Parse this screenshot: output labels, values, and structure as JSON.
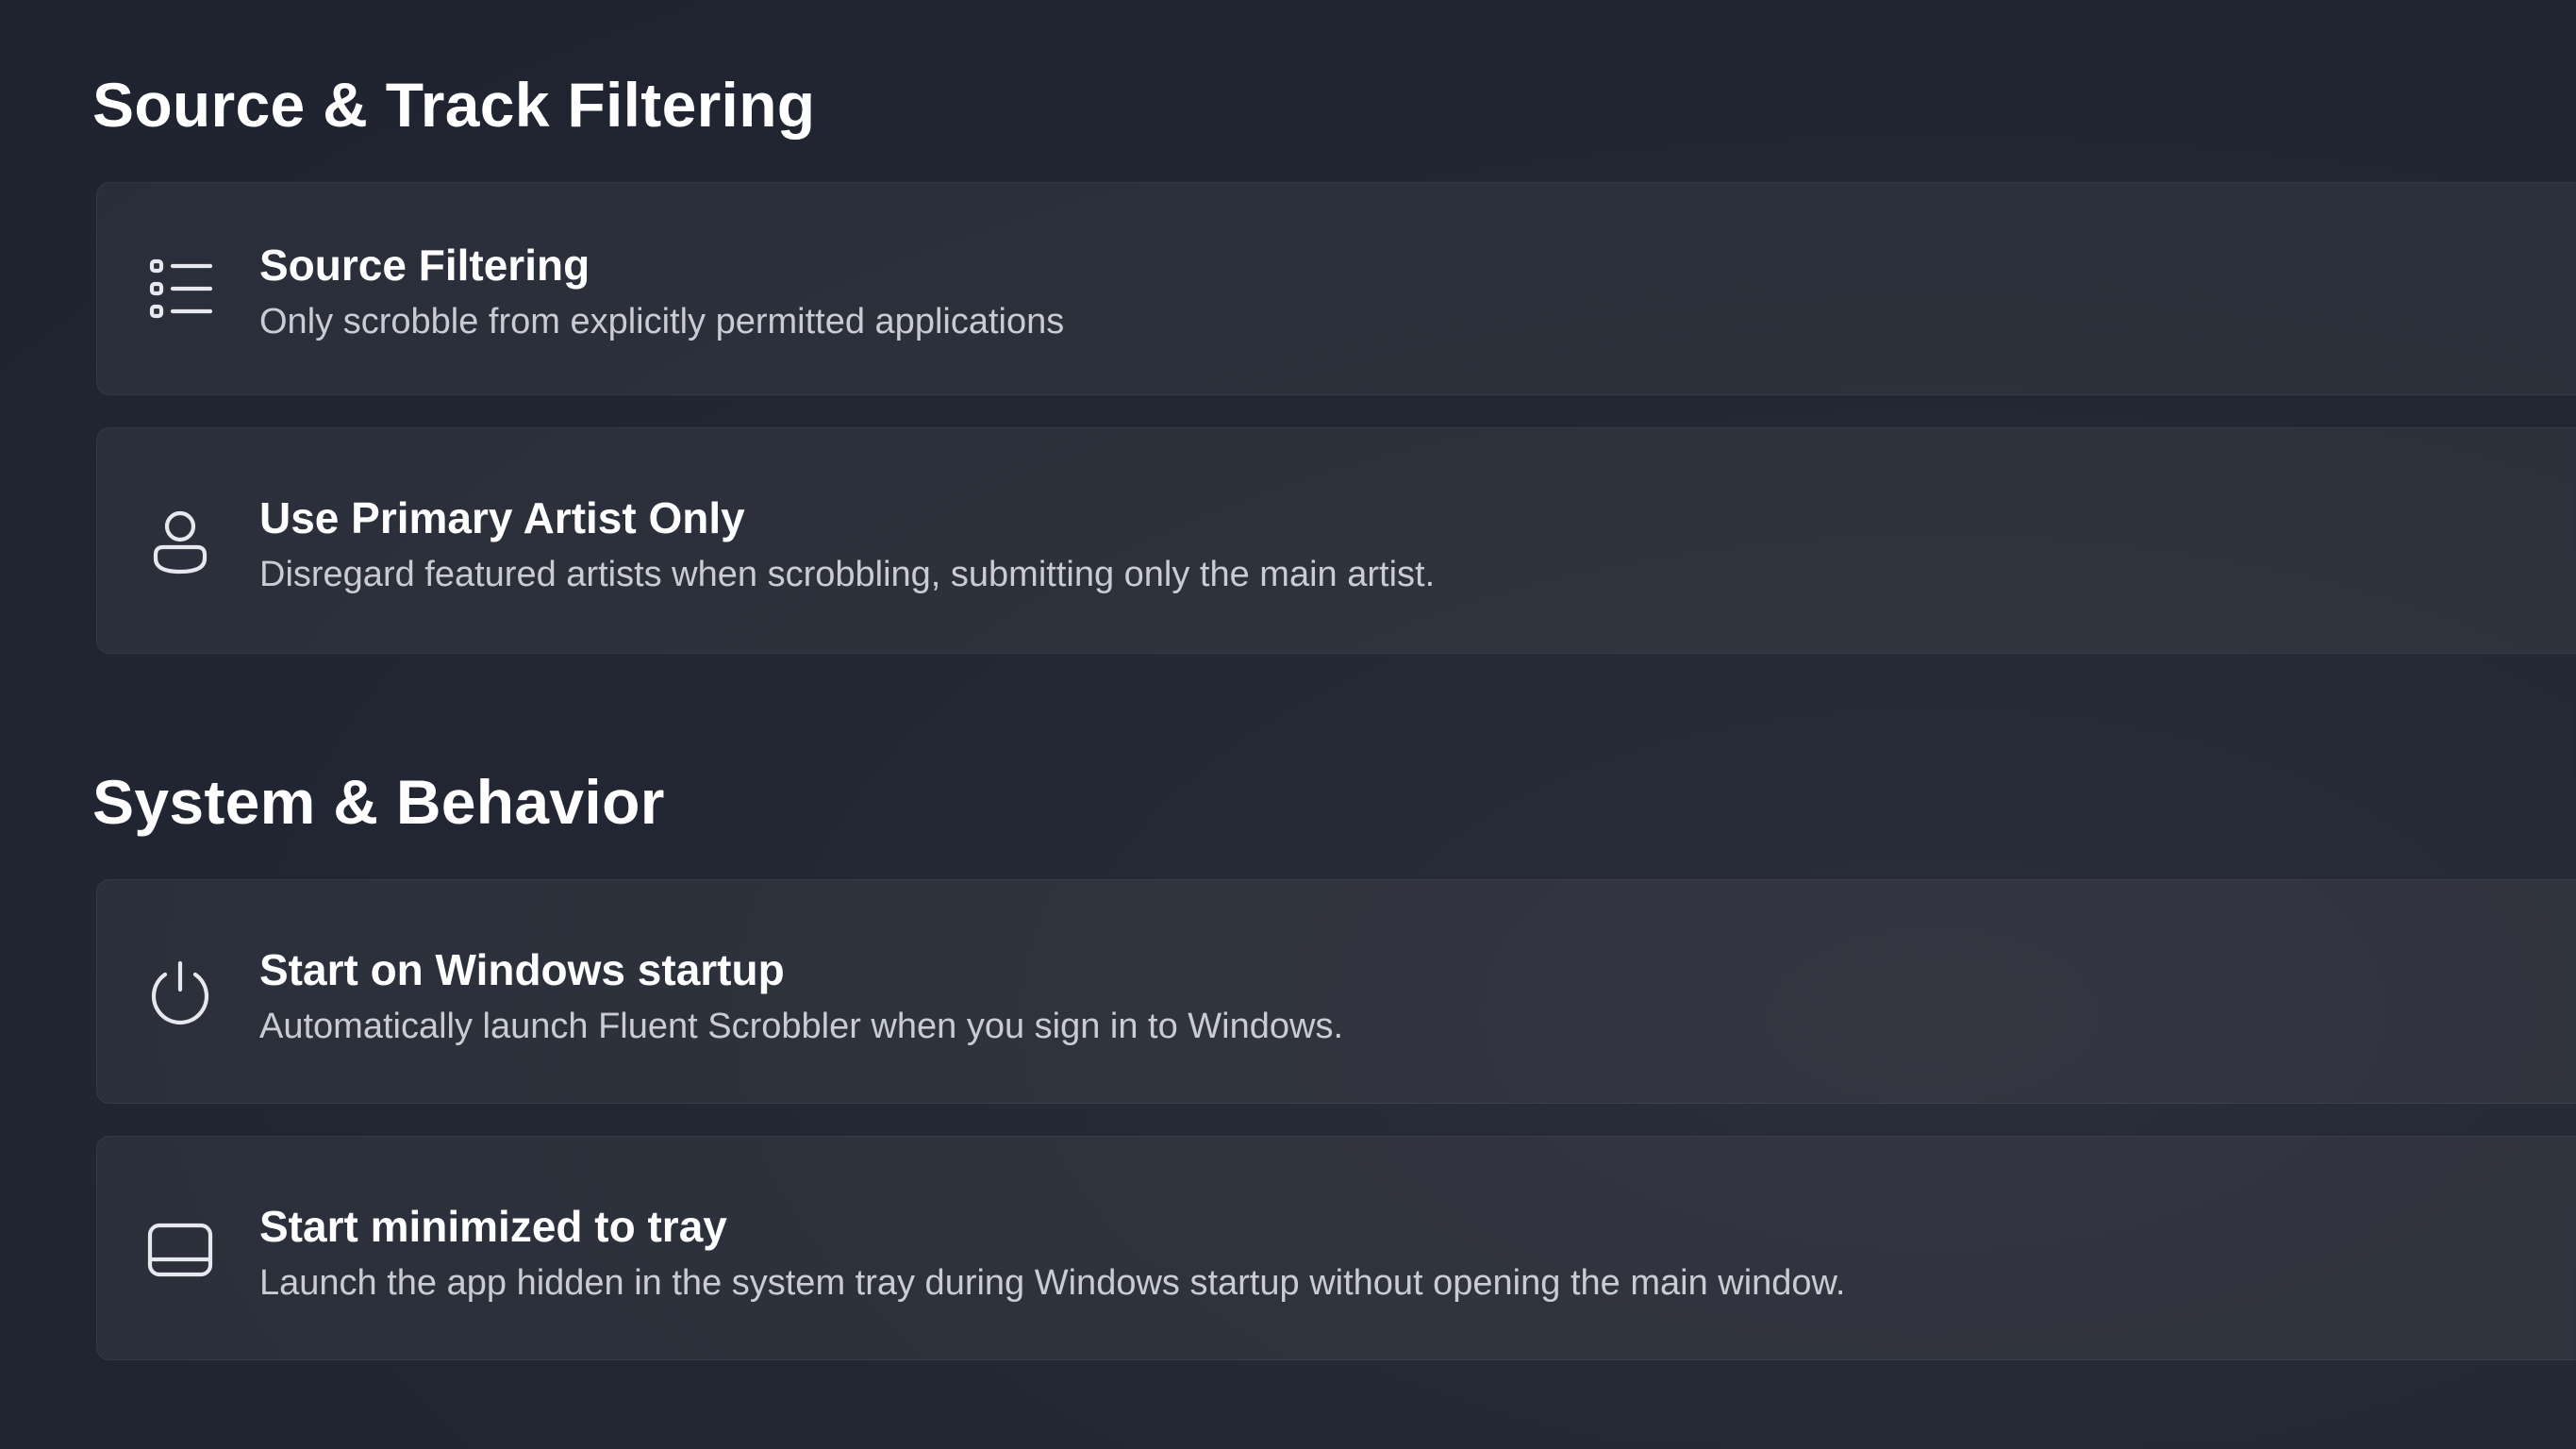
{
  "sections": [
    {
      "title": "Source & Track Filtering",
      "items": [
        {
          "icon": "list-icon",
          "title": "Source Filtering",
          "description": "Only scrobble from explicitly permitted applications"
        },
        {
          "icon": "person-icon",
          "title": "Use Primary Artist Only",
          "description": "Disregard featured artists when scrobbling, submitting only the main artist."
        }
      ]
    },
    {
      "title": "System & Behavior",
      "items": [
        {
          "icon": "power-icon",
          "title": "Start on Windows startup",
          "description": "Automatically launch Fluent Scrobbler when you sign in to Windows."
        },
        {
          "icon": "tray-window-icon",
          "title": "Start minimized to tray",
          "description": "Launch the app hidden in the system tray during Windows startup without opening the main window."
        }
      ]
    }
  ]
}
